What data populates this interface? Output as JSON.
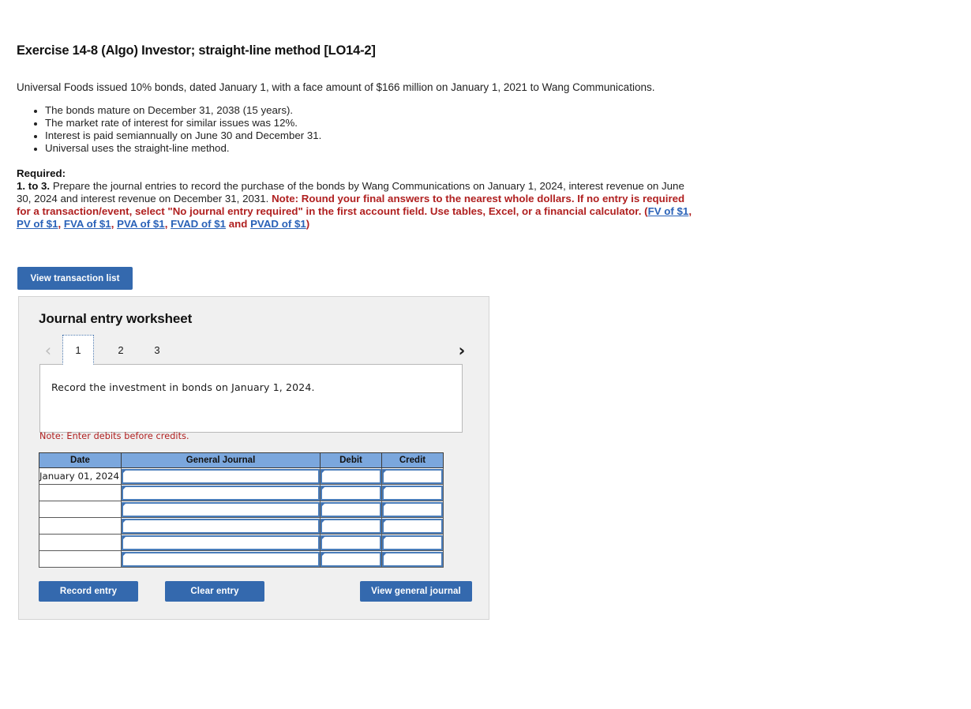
{
  "exercise": {
    "title": "Exercise 14-8 (Algo) Investor; straight-line method [LO14-2]",
    "intro": "Universal Foods issued 10% bonds, dated January 1, with a face amount of $166 million on January 1, 2021 to Wang Communications.",
    "bullets": [
      "The bonds mature on December 31, 2038 (15 years).",
      "The market rate of interest for similar issues was 12%.",
      "Interest is paid semiannually on June 30 and December 31.",
      "Universal uses the straight-line method."
    ],
    "required_label": "Required:",
    "required_number": "1. to 3.",
    "required_text": " Prepare the journal entries to record the purchase of the bonds by Wang Communications on January 1, 2024, interest revenue on June 30, 2024 and interest revenue on December 31, 2031.",
    "note_text": "Note: Round your final answers to the nearest whole dollars. If no entry is required for a transaction/event, select \"No journal entry required\" in the first account field. Use tables, Excel, or a financial calculator. ",
    "note_open_paren": "(",
    "note_and": " and ",
    "note_close_paren": ")",
    "links": [
      "FV of $1",
      "PV of $1",
      "FVA of $1",
      "PVA of $1",
      "FVAD of $1",
      "PVAD of $1"
    ],
    "link_separator": ", "
  },
  "toolbar": {
    "view_transaction_list_label": "View transaction list"
  },
  "worksheet": {
    "title": "Journal entry worksheet",
    "prev_icon": "chevron-left",
    "next_icon": "chevron-right",
    "tabs": [
      {
        "label": "1",
        "active": true
      },
      {
        "label": "2",
        "active": false
      },
      {
        "label": "3",
        "active": false
      }
    ],
    "description": "Record the investment in bonds on January 1, 2024.",
    "debit_note": "Note: Enter debits before credits.",
    "table": {
      "headers": [
        "Date",
        "General Journal",
        "Debit",
        "Credit"
      ],
      "rows": [
        {
          "date": "January 01, 2024",
          "general_journal": "",
          "debit": "",
          "credit": ""
        },
        {
          "date": "",
          "general_journal": "",
          "debit": "",
          "credit": ""
        },
        {
          "date": "",
          "general_journal": "",
          "debit": "",
          "credit": ""
        },
        {
          "date": "",
          "general_journal": "",
          "debit": "",
          "credit": ""
        },
        {
          "date": "",
          "general_journal": "",
          "debit": "",
          "credit": ""
        },
        {
          "date": "",
          "general_journal": "",
          "debit": "",
          "credit": ""
        }
      ]
    },
    "buttons": {
      "record_entry": "Record entry",
      "clear_entry": "Clear entry",
      "view_general_journal": "View general journal"
    }
  },
  "colors": {
    "button_blue": "#3469ae",
    "table_header_blue": "#7ba7dd",
    "cell_border_blue": "#4a7dba",
    "note_red": "#b02020",
    "link_blue": "#2a62b8",
    "panel_gray": "#f0f0f0"
  }
}
